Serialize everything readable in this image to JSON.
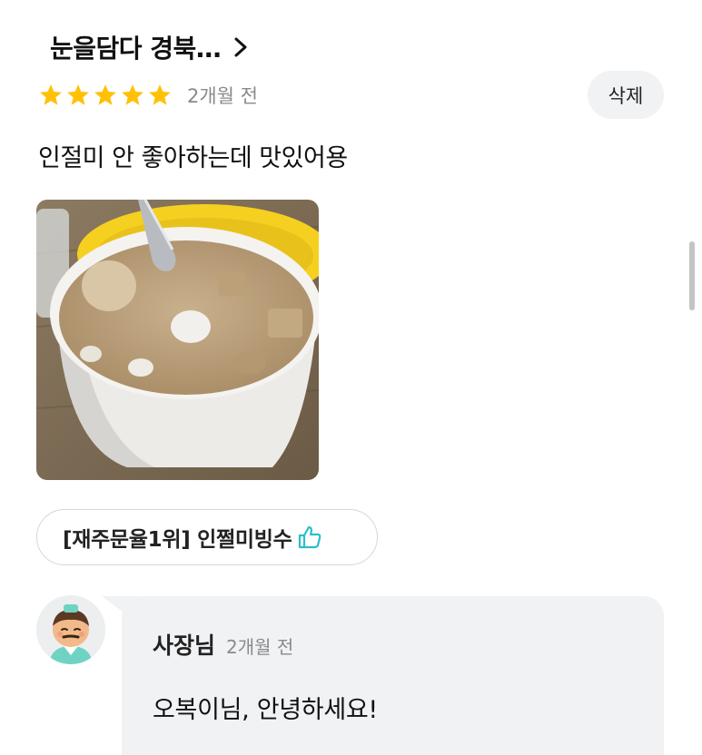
{
  "review": {
    "store_name": "눈을담다 경북…",
    "rating": 5,
    "max_rating": 5,
    "date": "2개월 전",
    "delete_label": "삭제",
    "text": "인절미 안 좋아하는데 맛있어용",
    "menu_chip": "[재주문율1위] 인쩔미빙수"
  },
  "owner_reply": {
    "name": "사장님",
    "date": "2개월 전",
    "text": "오복이님, 안녕하세요!"
  },
  "colors": {
    "star": "#FFC107",
    "thumbs_up": "#29BFC8",
    "bubble": "#F1F2F4",
    "bowl_rim": "#F5D020"
  },
  "icons": [
    "chevron-right-icon",
    "star-icon",
    "thumbs-up-icon",
    "owner-avatar-icon"
  ]
}
